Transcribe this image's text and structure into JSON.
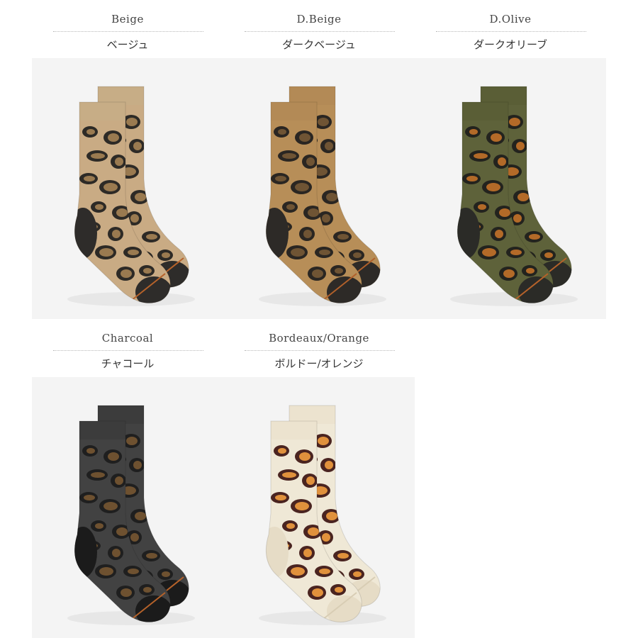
{
  "colors": [
    {
      "en": "Beige",
      "ja": "ベージュ",
      "bg": "#f4f4f4",
      "base": "#c9ab84",
      "cuff": "#c7ad86",
      "spot": "#2d2a26",
      "spotInner": "#9a7a50",
      "heel": "#2e2c2a",
      "stripe": "#b5622a"
    },
    {
      "en": "D.Beige",
      "ja": "ダークベージュ",
      "bg": "#f4f4f4",
      "base": "#b78e58",
      "cuff": "#b38a56",
      "spot": "#2a2622",
      "spotInner": "#6f5434",
      "heel": "#2d2a27",
      "stripe": "#b0602a"
    },
    {
      "en": "D.Olive",
      "ja": "ダークオリーブ",
      "bg": "#f4f4f4",
      "base": "#5e623a",
      "cuff": "#5a5e36",
      "spot": "#23231e",
      "spotInner": "#b36a28",
      "heel": "#2b2b27",
      "stripe": "#b5622a"
    },
    {
      "en": "Charcoal",
      "ja": "チャコール",
      "bg": "#f4f4f4",
      "base": "#424242",
      "cuff": "#3c3c3c",
      "spot": "#1f1f1f",
      "spotInner": "#6e5130",
      "heel": "#1b1b1b",
      "stripe": "#b5622a"
    },
    {
      "en": "Bordeaux/Orange",
      "ja": "ボルドー/オレンジ",
      "bg": "#f4f4f4",
      "base": "#efe8d6",
      "cuff": "#ece3cf",
      "spot": "#4a2420",
      "spotInner": "#e0913c",
      "heel": "#e6dcc6",
      "stripe": "#d8cdb4"
    }
  ]
}
